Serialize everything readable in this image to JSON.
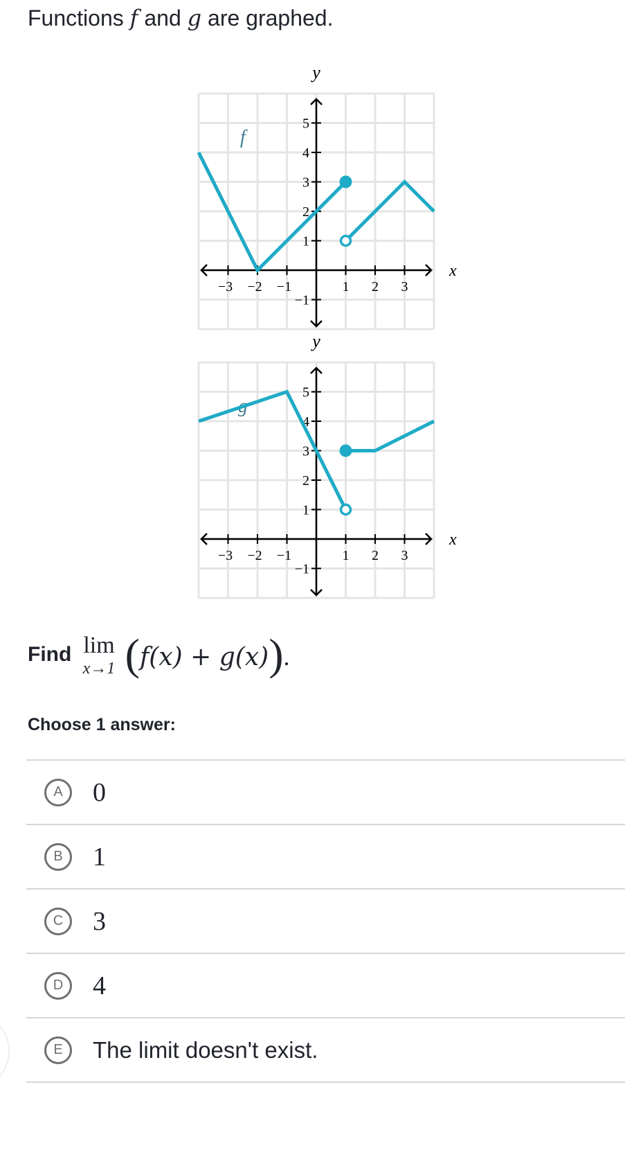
{
  "title": {
    "prefix": "Functions",
    "f": "f",
    "and": "and",
    "g": "g",
    "suffix": "are graphed."
  },
  "chart_data": [
    {
      "type": "line",
      "function_label": "f",
      "xlabel": "x",
      "ylabel": "y",
      "xlim": [
        -4,
        4
      ],
      "ylim": [
        -2,
        6
      ],
      "grid": true,
      "x_ticks": [
        -3,
        -2,
        -1,
        1,
        2,
        3
      ],
      "x_tick_labels": [
        "−3",
        "−2",
        "−1",
        "1",
        "2",
        "3"
      ],
      "y_ticks": [
        -1,
        1,
        2,
        3,
        4,
        5
      ],
      "y_tick_labels": [
        "−1",
        "1",
        "2",
        "3",
        "4",
        "5"
      ],
      "color": "#1fabc7",
      "segments": [
        {
          "points": [
            [
              -4,
              4
            ],
            [
              -2,
              0
            ],
            [
              1,
              3
            ]
          ]
        },
        {
          "points": [
            [
              1,
              1
            ],
            [
              3,
              3
            ],
            [
              4,
              2
            ]
          ]
        }
      ],
      "closed_points": [
        [
          1,
          3
        ]
      ],
      "open_points": [
        [
          1,
          1
        ]
      ]
    },
    {
      "type": "line",
      "function_label": "g",
      "xlabel": "x",
      "ylabel": "y",
      "xlim": [
        -4,
        4
      ],
      "ylim": [
        -2,
        6
      ],
      "grid": true,
      "x_ticks": [
        -3,
        -2,
        -1,
        1,
        2,
        3
      ],
      "x_tick_labels": [
        "−3",
        "−2",
        "−1",
        "1",
        "2",
        "3"
      ],
      "y_ticks": [
        -1,
        1,
        2,
        3,
        4,
        5
      ],
      "y_tick_labels": [
        "−1",
        "1",
        "2",
        "3",
        "4",
        "5"
      ],
      "color": "#1fabc7",
      "segments": [
        {
          "points": [
            [
              -4,
              4
            ],
            [
              -1,
              5
            ],
            [
              1,
              1
            ]
          ]
        },
        {
          "points": [
            [
              1,
              3
            ],
            [
              2,
              3
            ],
            [
              4,
              4
            ]
          ]
        }
      ],
      "closed_points": [
        [
          1,
          3
        ]
      ],
      "open_points": [
        [
          1,
          1
        ]
      ]
    }
  ],
  "question": {
    "find": "Find",
    "lim": "lim",
    "lim_sub": "x→1",
    "open_paren": "(",
    "expression": "f(x) + g(x)",
    "close_paren": ")",
    "period": "."
  },
  "choose_label": "Choose 1 answer:",
  "choices": [
    {
      "letter": "A",
      "text": "0"
    },
    {
      "letter": "B",
      "text": "1"
    },
    {
      "letter": "C",
      "text": "3"
    },
    {
      "letter": "D",
      "text": "4"
    },
    {
      "letter": "E",
      "text": "The limit doesn't exist."
    }
  ]
}
